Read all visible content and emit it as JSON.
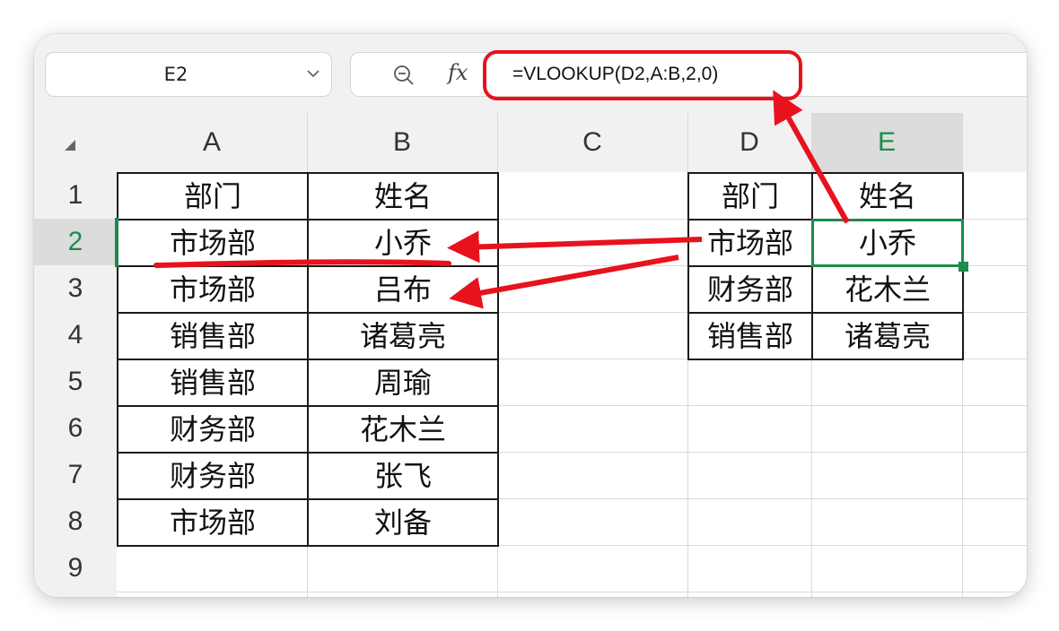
{
  "formula_bar": {
    "name_box": "E2",
    "formula": "=VLOOKUP(D2,A:B,2,0)",
    "fx_label": "fx"
  },
  "columns": [
    "A",
    "B",
    "C",
    "D",
    "E"
  ],
  "rows": [
    "1",
    "2",
    "3",
    "4",
    "5",
    "6",
    "7",
    "8",
    "9"
  ],
  "selected_cell": {
    "column": "E",
    "row": "2"
  },
  "table_left": {
    "cells": [
      [
        "部门",
        "姓名"
      ],
      [
        "市场部",
        "小乔"
      ],
      [
        "市场部",
        "吕布"
      ],
      [
        "销售部",
        "诸葛亮"
      ],
      [
        "销售部",
        "周瑜"
      ],
      [
        "财务部",
        "花木兰"
      ],
      [
        "财务部",
        "张飞"
      ],
      [
        "市场部",
        "刘备"
      ]
    ]
  },
  "table_right": {
    "cells": [
      [
        "部门",
        "姓名"
      ],
      [
        "市场部",
        "小乔"
      ],
      [
        "财务部",
        "花木兰"
      ],
      [
        "销售部",
        "诸葛亮"
      ]
    ]
  },
  "colors": {
    "accent_green": "#1d8a4b",
    "annotation_red": "#e8121d",
    "header_bg": "#f1f1f1"
  },
  "icons": {
    "name_box_dropdown": "chevron-down-icon",
    "zoom": "zoom-out-icon",
    "function": "fx-icon"
  }
}
